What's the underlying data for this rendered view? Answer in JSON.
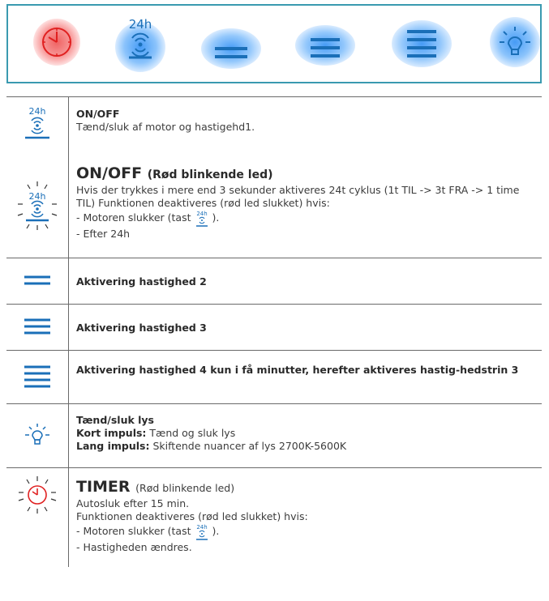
{
  "panel": {
    "buttons": [
      {
        "icon": "clock-timer-icon",
        "glow": "#e85a5a"
      },
      {
        "icon": "fan-24h-icon",
        "label": "24h",
        "glow": "#3c96f5"
      },
      {
        "icon": "speed-2-icon",
        "glow": "#3c96f5"
      },
      {
        "icon": "speed-3-icon",
        "glow": "#3c96f5"
      },
      {
        "icon": "speed-4-icon",
        "glow": "#3c96f5"
      },
      {
        "icon": "light-bulb-icon",
        "glow": "#3c96f5"
      }
    ],
    "border_color": "#3a9ab0",
    "icon_color": "#1a6fb8"
  },
  "rows": [
    {
      "icon": "fan-24h-icon",
      "title": "ON/OFF",
      "text": "Tænd/sluk af motor og hastigehd1."
    },
    {
      "icon": "fan-24h-blinking-icon",
      "title": "ON/OFF",
      "title_suffix": "(Rød blinkende led)",
      "text": "Hvis der trykkes i mere end 3 sekunder aktiveres 24t cyklus (1t TIL -> 3t FRA -> 1 time TIL) Funktionen deaktiveres (rød led slukket) hvis:",
      "bullet1_before": "- Motoren slukker (tast",
      "bullet1_after": ").",
      "bullet2": "- Efter 24h"
    },
    {
      "icon": "speed-2-icon",
      "title": "Aktivering hastighed 2"
    },
    {
      "icon": "speed-3-icon",
      "title": "Aktivering hastighed 3"
    },
    {
      "icon": "speed-4-icon",
      "title": "Aktivering hastighed 4 kun i få minutter, herefter aktiveres hastig-hedstrin 3"
    },
    {
      "icon": "light-bulb-icon",
      "title": "Tænd/sluk lys",
      "short_label": "Kort impuls:",
      "short_text": "Tænd og sluk lys",
      "long_label": "Lang impuls:",
      "long_text": "Skiftende nuancer af lys 2700K-5600K"
    },
    {
      "icon": "clock-timer-blinking-icon",
      "title": "TIMER",
      "title_suffix": "(Rød blinkende led)",
      "line1": "Autosluk efter 15 min.",
      "line2": "Funktionen deaktiveres (rød led slukket) hvis:",
      "bullet1_before": "- Motoren slukker (tast",
      "bullet1_after": ").",
      "bullet2": "- Hastigheden ændres."
    }
  ],
  "icon_label_24h": "24h"
}
